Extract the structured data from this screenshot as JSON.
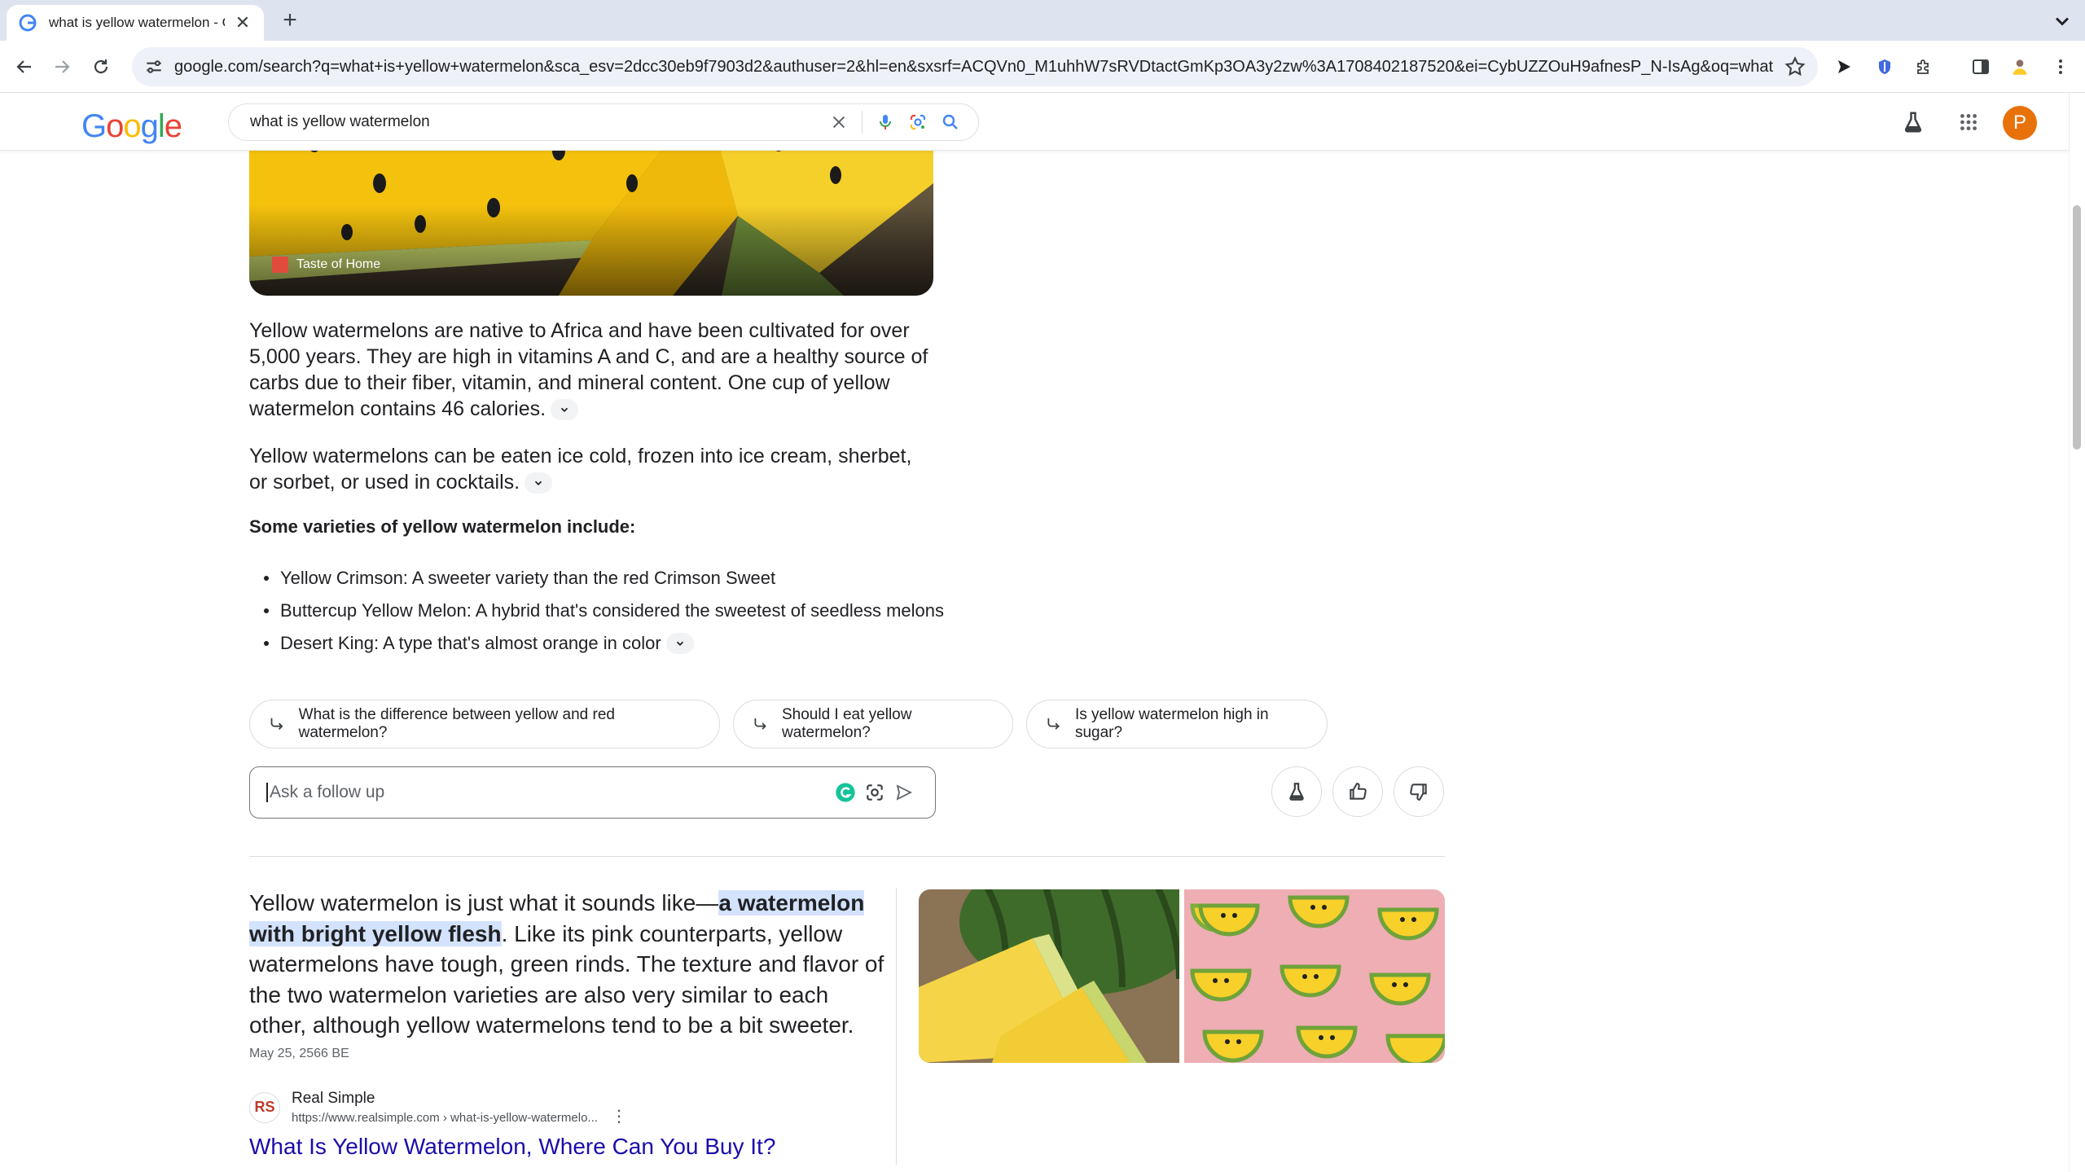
{
  "browser": {
    "tab_title": "what is yellow watermelon - G",
    "new_tab": "+",
    "url": "google.com/search?q=what+is+yellow+watermelon&sca_esv=2dcc30eb9f7903d2&authuser=2&hl=en&sxsrf=ACQVn0_M1uhhW7sRVDtactGmKp3OA3y2zw%3A1708402187520&ei=CybUZZOuH9afnesP_N-IsAg&oq=what+..."
  },
  "google": {
    "logo": [
      "G",
      "o",
      "o",
      "g",
      "l",
      "e"
    ],
    "query": "what is yellow watermelon",
    "avatar_letter": "P"
  },
  "overview": {
    "hero_source": "Taste of Home",
    "para1": "Yellow watermelons are native to Africa and have been cultivated for over 5,000 years. They are high in vitamins A and C, and are a healthy source of carbs due to their fiber, vitamin, and mineral content. One cup of yellow watermelon contains 46 calories.",
    "para2": "Yellow watermelons can be eaten ice cold, frozen into ice cream, sherbet, or sorbet, or used in cocktails.",
    "varieties_heading": "Some varieties of yellow watermelon include:",
    "varieties": [
      "Yellow Crimson: A sweeter variety than the red Crimson Sweet",
      "Buttercup Yellow Melon: A hybrid that's considered the sweetest of seedless melons",
      "Desert King: A type that's almost orange in color"
    ],
    "chips": [
      "What is the difference between yellow and red watermelon?",
      "Should I eat yellow watermelon?",
      "Is yellow watermelon high in sugar?"
    ],
    "followup_placeholder": "Ask a follow up"
  },
  "featured": {
    "snippet_before": "Yellow watermelon is just what it sounds like—",
    "snippet_highlight": "a watermelon with bright yellow flesh",
    "snippet_after": ". Like its pink counterparts, yellow watermelons have tough, green rinds. The texture and flavor of the two watermelon varieties are also very similar to each other, although yellow watermelons tend to be a bit sweeter.",
    "date": "May 25, 2566 BE",
    "source_logo": "RS",
    "source_name": "Real Simple",
    "source_cite": "https://www.realsimple.com › what-is-yellow-watermelo...",
    "result_title": "What Is Yellow Watermelon, Where Can You Buy It?"
  },
  "colors": {
    "link": "#1a0dab",
    "highlight": "#d3e3fd",
    "avatar": "#e8710a",
    "tabbar": "#dee3f0"
  }
}
